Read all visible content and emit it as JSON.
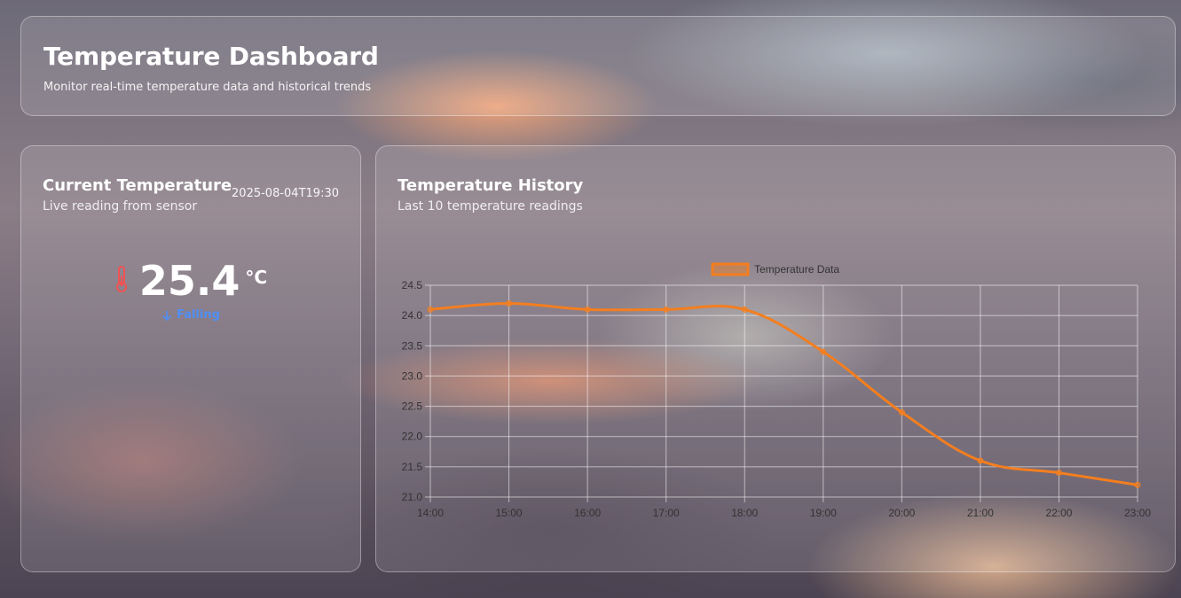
{
  "header": {
    "title": "Temperature Dashboard",
    "subtitle": "Monitor real-time temperature data and historical trends"
  },
  "current": {
    "title": "Current Temperature",
    "subtitle": "Live reading from sensor",
    "timestamp": "2025-08-04T19:30",
    "value": "25.4",
    "unit": "°C",
    "trend": "Falling",
    "icons": {
      "thermometer": "thermometer-icon",
      "trend": "arrow-down-icon"
    },
    "colors": {
      "thermometer": "#f05252",
      "trend": "#4f8ff7"
    }
  },
  "history": {
    "title": "Temperature History",
    "subtitle": "Last 10 temperature readings"
  },
  "chart_data": {
    "type": "line",
    "x": [
      "14:00",
      "15:00",
      "16:00",
      "17:00",
      "18:00",
      "19:00",
      "20:00",
      "21:00",
      "22:00",
      "23:00"
    ],
    "series": [
      {
        "name": "Temperature Data",
        "values": [
          24.1,
          24.2,
          24.1,
          24.1,
          24.1,
          23.4,
          22.4,
          21.6,
          21.4,
          21.2
        ],
        "color": "#f47e1f"
      }
    ],
    "ylim": [
      21.0,
      24.5
    ],
    "yticks": [
      "21.0",
      "21.5",
      "22.0",
      "22.5",
      "23.0",
      "23.5",
      "24.0",
      "24.5"
    ],
    "grid": true,
    "legend": "top-center",
    "title": "",
    "xlabel": "",
    "ylabel": ""
  }
}
